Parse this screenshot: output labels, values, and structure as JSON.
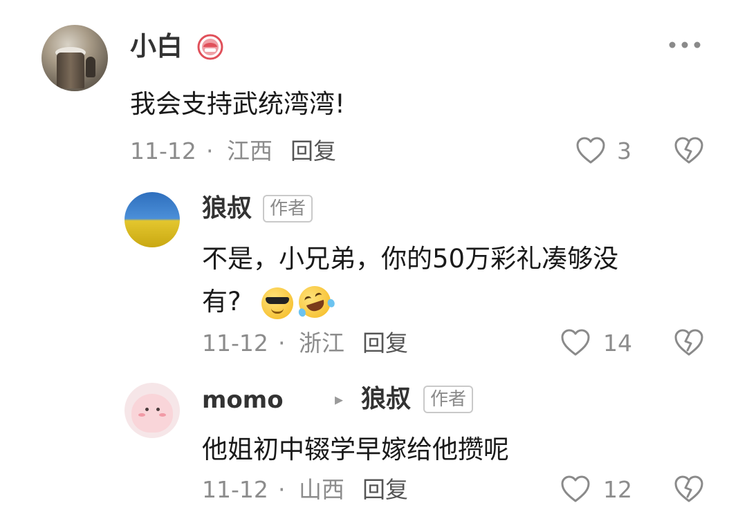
{
  "comments": [
    {
      "name": "小白",
      "badge_icon": "level-badge-icon",
      "text": "我会支持武统湾湾!",
      "date": "11-12",
      "separator": "·",
      "location": "江西",
      "reply_label": "回复",
      "likes": "3"
    },
    {
      "name": "狼叔",
      "author_badge": "作者",
      "text_line1": "不是，小兄弟，你的50万彩礼凑够没",
      "text_line2": "有?",
      "emojis": [
        "sunglasses-emoji",
        "rofl-emoji"
      ],
      "date": "11-12",
      "separator": "·",
      "location": "浙江",
      "reply_label": "回复",
      "likes": "14"
    },
    {
      "name": "momo",
      "reply_to_arrow": "▸",
      "reply_to_name": "狼叔",
      "author_badge": "作者",
      "text": "他姐初中辍学早嫁给他攒呢",
      "date": "11-12",
      "separator": "·",
      "location": "山西",
      "reply_label": "回复",
      "likes": "12"
    }
  ],
  "more_icon": "more-dots-icon",
  "colors": {
    "text_primary": "#1a1a1a",
    "text_secondary": "#8c8c8c",
    "icon_gray": "#8a8a8a",
    "badge_red": "#e0505a"
  }
}
